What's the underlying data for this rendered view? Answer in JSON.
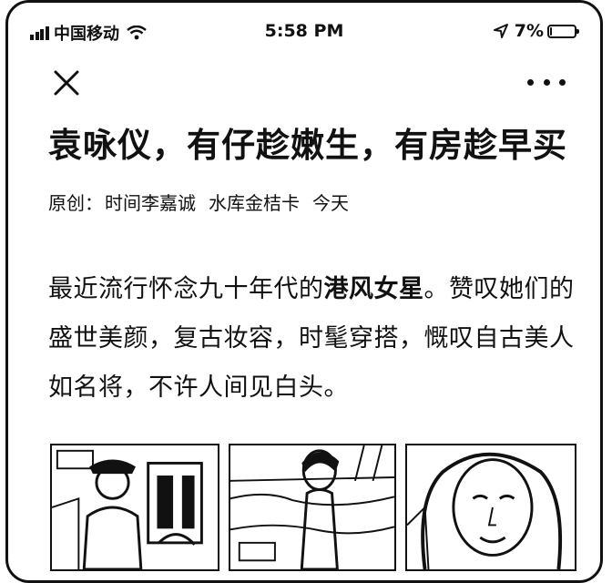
{
  "status_bar": {
    "carrier": "中国移动",
    "time": "5:58 PM",
    "battery": "7%",
    "battery_level": 0.07
  },
  "nav": {
    "close_icon": "close-icon",
    "more_icon": "more-icon"
  },
  "article": {
    "title": "袁咏仪，有仔趁嫩生，有房趁早买",
    "meta": {
      "label": "原创：",
      "author": "时间李嘉诚",
      "account": "水库金桔卡",
      "date": "今天"
    },
    "body_before": "最近流行怀念九十年代的",
    "body_bold": "港风女星",
    "body_after": "。赞叹她们的盛世美颜，复古妆容，时髦穿搭，慨叹自古美人如名将，不许人间见白头。"
  }
}
